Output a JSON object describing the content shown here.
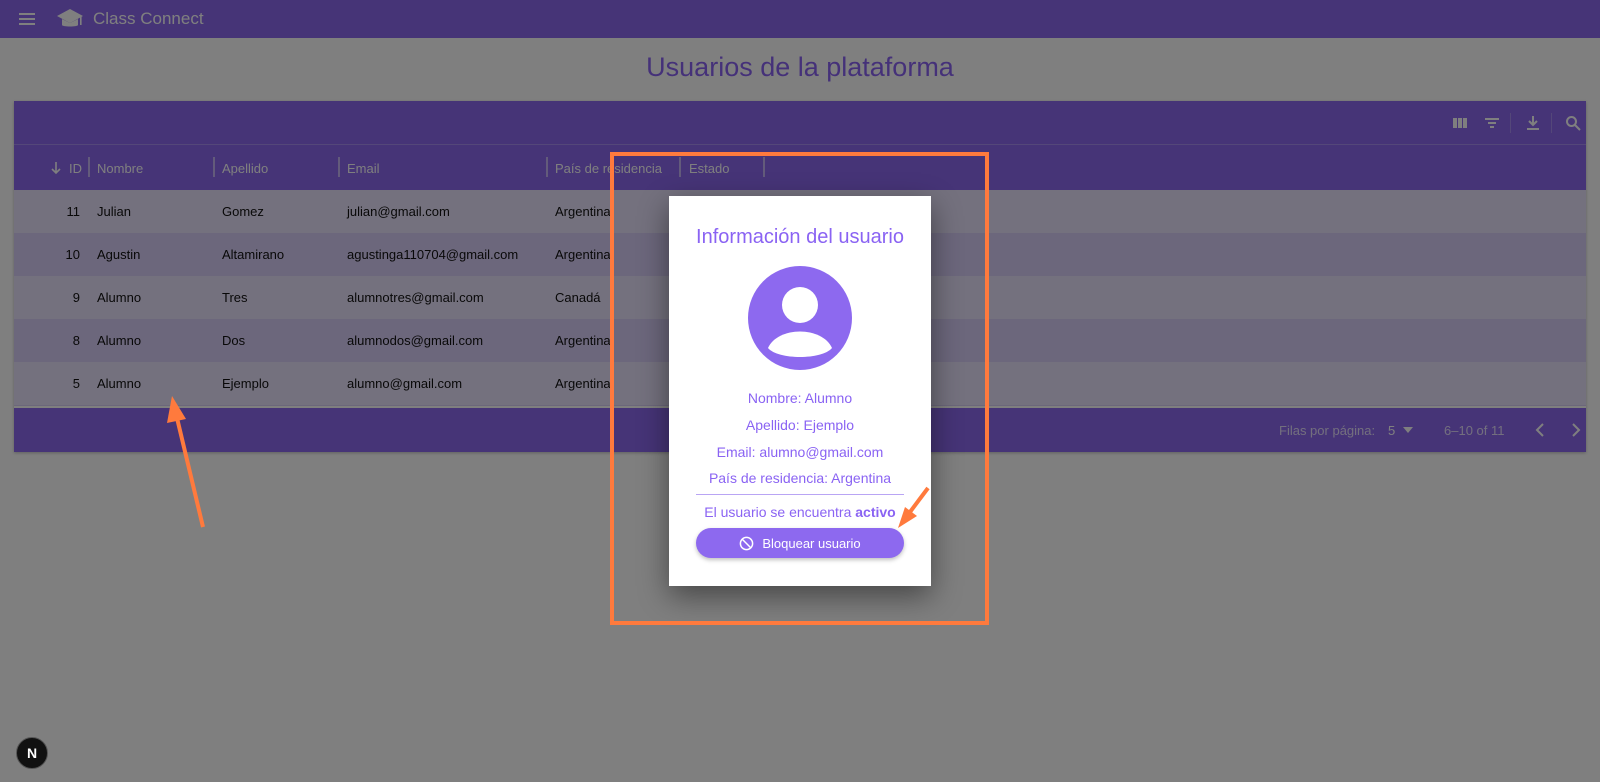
{
  "app": {
    "brand": "Class Connect",
    "accent": "#8d69ef",
    "icons": [
      "menu-icon",
      "graduation-cap-icon"
    ]
  },
  "page": {
    "title": "Usuarios de la plataforma"
  },
  "toolbar": {
    "icons": [
      "columns-icon",
      "filter-icon",
      "download-icon",
      "search-icon"
    ]
  },
  "table": {
    "columns": [
      "ID",
      "Nombre",
      "Apellido",
      "Email",
      "País de residencia",
      "Estado"
    ],
    "rows": [
      {
        "id": "11",
        "nombre": "Julian",
        "apellido": "Gomez",
        "email": "julian@gmail.com",
        "pais": "Argentina"
      },
      {
        "id": "10",
        "nombre": "Agustin",
        "apellido": "Altamirano",
        "email": "agustinga110704@gmail.com",
        "pais": "Argentina"
      },
      {
        "id": "9",
        "nombre": "Alumno",
        "apellido": "Tres",
        "email": "alumnotres@gmail.com",
        "pais": "Canadá"
      },
      {
        "id": "8",
        "nombre": "Alumno",
        "apellido": "Dos",
        "email": "alumnodos@gmail.com",
        "pais": "Argentina"
      },
      {
        "id": "5",
        "nombre": "Alumno",
        "apellido": "Ejemplo",
        "email": "alumno@gmail.com",
        "pais": "Argentina"
      }
    ],
    "footer": {
      "rows_per_page_label": "Filas por página:",
      "rows_per_page_value": "5",
      "range": "6–10 of 11"
    }
  },
  "modal": {
    "title": "Información del usuario",
    "nombre": "Nombre: Alumno",
    "apellido": "Apellido: Ejemplo",
    "email": "Email: alumno@gmail.com",
    "pais": "País de residencia: Argentina",
    "status_prefix": "El usuario se encuentra",
    "status_value": "activo",
    "block_button": "Bloquear usuario",
    "avatar_color": "#8d69ef"
  },
  "badge": {
    "label": "N"
  },
  "annotation_color": "#ff7a3d"
}
